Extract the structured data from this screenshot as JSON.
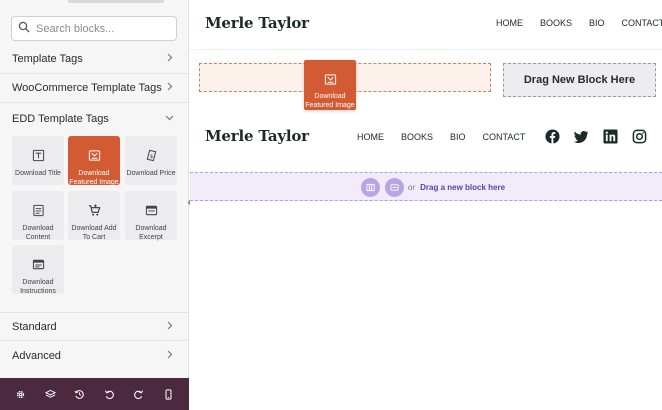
{
  "sidebar": {
    "search_placeholder": "Search blocks...",
    "sections": [
      {
        "label": "Template Tags"
      },
      {
        "label": "WooCommerce Template Tags"
      },
      {
        "label": "EDD Template Tags"
      },
      {
        "label": "Standard"
      },
      {
        "label": "Advanced"
      }
    ],
    "blocks": [
      {
        "label1": "Download Title",
        "label2": ""
      },
      {
        "label1": "Download",
        "label2": "Featured Image"
      },
      {
        "label1": "Download Price",
        "label2": ""
      },
      {
        "label1": "Download",
        "label2": "Content"
      },
      {
        "label1": "Download Add",
        "label2": "To Cart"
      },
      {
        "label1": "Download",
        "label2": "Excerpt"
      },
      {
        "label1": "Download",
        "label2": "Instructions"
      }
    ]
  },
  "canvas": {
    "header1": {
      "logo": "Merle Taylor",
      "nav": [
        "HOME",
        "BOOKS",
        "BIO",
        "CONTACT"
      ]
    },
    "drag_button": "Drag New Block Here",
    "ghost": {
      "line1": "Download",
      "line2": "Featured Image"
    },
    "header2": {
      "logo": "Merle Taylor",
      "nav": [
        "HOME",
        "BOOKS",
        "BIO",
        "CONTACT"
      ]
    },
    "add_bar": {
      "or": "or",
      "link": "Drag a new block here"
    }
  },
  "colors": {
    "accent": "#d35b33",
    "bottom_bar": "#4b2a3f",
    "purple": "#b9a3e4"
  }
}
